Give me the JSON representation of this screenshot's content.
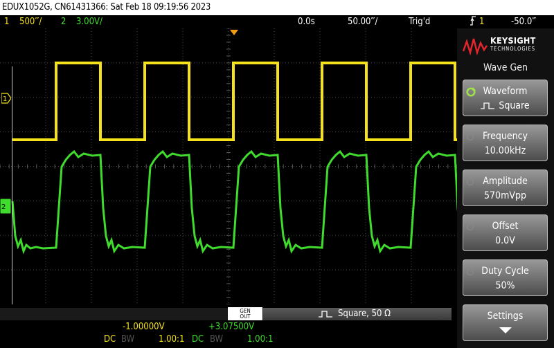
{
  "title": "EDUX1052G, CN61431366: Sat Feb 18 09:19:56 2023",
  "status": {
    "ch1_num": "1",
    "ch1_scale": "500‴/",
    "ch2_num": "2",
    "ch2_scale": "3.00V/",
    "time_offset": "0.0s",
    "time_scale": "50.00‴/",
    "trigger_state": "Trig'd",
    "trigger_channel": "1",
    "trigger_level": "-50.0‴"
  },
  "softpanel": {
    "brand": "KEYSIGHT",
    "brand_sub": "TECHNOLOGIES",
    "menu_title": "Wave Gen",
    "keys": [
      {
        "label": "Waveform",
        "value": "Square"
      },
      {
        "label": "Frequency",
        "value": "10.00kHz"
      },
      {
        "label": "Amplitude",
        "value": "570mVpp"
      },
      {
        "label": "Offset",
        "value": "0.0V"
      },
      {
        "label": "Duty Cycle",
        "value": "50%"
      },
      {
        "label": "Settings",
        "value": ""
      }
    ]
  },
  "bottom": {
    "gen_out_line1": "GEN",
    "gen_out_line2": "OUT",
    "gen_wave": "Square, 50 Ω",
    "ch1_offset": "-1.00000V",
    "ch2_offset": "+3.07500V",
    "ch1_coupling": "DC",
    "ch1_bw": "BW",
    "ch1_probe": "1.00:1",
    "ch2_coupling": "DC",
    "ch2_bw": "BW",
    "ch2_probe": "1.00:1"
  },
  "markers": {
    "ch1_marker": "1",
    "ch2_marker": "2",
    "trigger_marker": "T"
  },
  "colors": {
    "ch1": "#f5e21b",
    "ch2": "#3fdc2e",
    "trigger": "#f39c12",
    "logo_red": "#e3262e"
  }
}
